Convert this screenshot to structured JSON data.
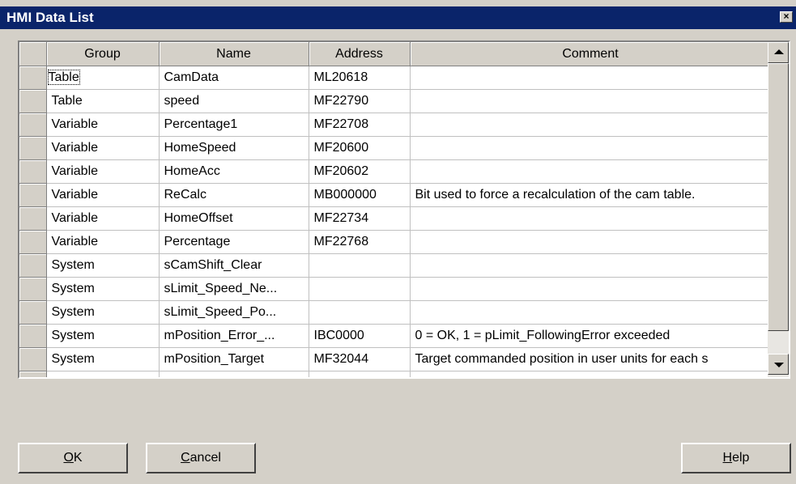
{
  "window": {
    "title": "HMI Data List",
    "close_glyph": "×"
  },
  "grid": {
    "columns": [
      "Group",
      "Name",
      "Address",
      "Comment"
    ],
    "rows": [
      {
        "group": "Table",
        "name": "CamData",
        "address": "ML20618",
        "comment": ""
      },
      {
        "group": "Table",
        "name": "speed",
        "address": "MF22790",
        "comment": ""
      },
      {
        "group": "Variable",
        "name": "Percentage1",
        "address": "MF22708",
        "comment": ""
      },
      {
        "group": "Variable",
        "name": "HomeSpeed",
        "address": "MF20600",
        "comment": ""
      },
      {
        "group": "Variable",
        "name": "HomeAcc",
        "address": "MF20602",
        "comment": ""
      },
      {
        "group": "Variable",
        "name": "ReCalc",
        "address": "MB000000",
        "comment": "Bit used to force a recalculation of the cam table."
      },
      {
        "group": "Variable",
        "name": "HomeOffset",
        "address": "MF22734",
        "comment": ""
      },
      {
        "group": "Variable",
        "name": "Percentage",
        "address": "MF22768",
        "comment": ""
      },
      {
        "group": "System",
        "name": "sCamShift_Clear",
        "address": "",
        "comment": ""
      },
      {
        "group": "System",
        "name": "sLimit_Speed_Ne...",
        "address": "",
        "comment": ""
      },
      {
        "group": "System",
        "name": "sLimit_Speed_Po...",
        "address": "",
        "comment": ""
      },
      {
        "group": "System",
        "name": "mPosition_Error_...",
        "address": "IBC0000",
        "comment": "0 = OK, 1 = pLimit_FollowingError exceeded"
      },
      {
        "group": "System",
        "name": "mPosition_Target",
        "address": "MF32044",
        "comment": "Target commanded position in user units for each s"
      }
    ]
  },
  "buttons": {
    "ok": {
      "mnemonic": "O",
      "rest": "K"
    },
    "cancel": {
      "mnemonic": "C",
      "rest": "ancel"
    },
    "help": {
      "mnemonic": "H",
      "rest": "elp"
    }
  },
  "icons": {
    "scroll_up": "triangle-up-icon",
    "scroll_down": "triangle-down-icon",
    "close": "close-icon"
  }
}
